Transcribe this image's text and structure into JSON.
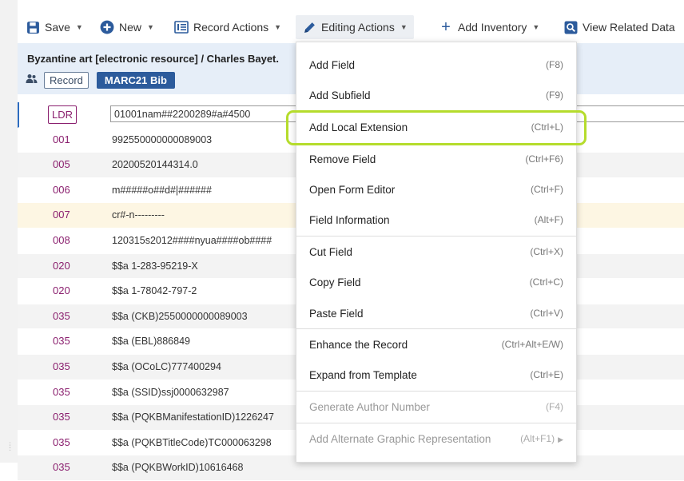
{
  "toolbar": {
    "save": "Save",
    "new": "New",
    "record_actions": "Record Actions",
    "editing_actions": "Editing Actions",
    "add_inventory": "Add Inventory",
    "view_related": "View Related Data"
  },
  "record": {
    "title": "Byzantine art [electronic resource] / Charles Bayet.",
    "badge_record": "Record",
    "badge_format": "MARC21 Bib"
  },
  "rows": [
    {
      "tag": "LDR",
      "value": "01001nam##2200289#a#4500"
    },
    {
      "tag": "001",
      "value": "992550000000089003"
    },
    {
      "tag": "005",
      "value": "20200520144314.0"
    },
    {
      "tag": "006",
      "value": "m#####o##d#|######"
    },
    {
      "tag": "007",
      "value": "cr#-n---------"
    },
    {
      "tag": "008",
      "value": "120315s2012####nyua####ob####"
    },
    {
      "tag": "020",
      "value": "$$a 1-283-95219-X"
    },
    {
      "tag": "020",
      "value": "$$a 1-78042-797-2"
    },
    {
      "tag": "035",
      "value": "$$a (CKB)2550000000089003"
    },
    {
      "tag": "035",
      "value": "$$a (EBL)886849"
    },
    {
      "tag": "035",
      "value": "$$a (OCoLC)777400294"
    },
    {
      "tag": "035",
      "value": "$$a (SSID)ssj0000632987"
    },
    {
      "tag": "035",
      "value": "$$a (PQKBManifestationID)1226247"
    },
    {
      "tag": "035",
      "value": "$$a (PQKBTitleCode)TC000063298"
    },
    {
      "tag": "035",
      "value": "$$a (PQKBWorkID)10616468"
    }
  ],
  "menu": {
    "items": [
      {
        "label": "Add Field",
        "shortcut": "(F8)"
      },
      {
        "label": "Add Subfield",
        "shortcut": "(F9)"
      },
      {
        "label": "Add Local Extension",
        "shortcut": "(Ctrl+L)"
      },
      {
        "label": "Remove Field",
        "shortcut": "(Ctrl+F6)"
      },
      {
        "label": "Open Form Editor",
        "shortcut": "(Ctrl+F)"
      },
      {
        "label": "Field Information",
        "shortcut": "(Alt+F)"
      },
      {
        "label": "Cut Field",
        "shortcut": "(Ctrl+X)"
      },
      {
        "label": "Copy Field",
        "shortcut": "(Ctrl+C)"
      },
      {
        "label": "Paste Field",
        "shortcut": "(Ctrl+V)"
      },
      {
        "label": "Enhance the Record",
        "shortcut": "(Ctrl+Alt+E/W)"
      },
      {
        "label": "Expand from Template",
        "shortcut": "(Ctrl+E)"
      },
      {
        "label": "Generate Author Number",
        "shortcut": "(F4)"
      },
      {
        "label": "Add Alternate Graphic Representation",
        "shortcut": "(Alt+F1)"
      }
    ]
  },
  "colors": {
    "tag": "#8a1f6e",
    "accent": "#2c5b9c",
    "header_bg": "#e6eef8",
    "highlight_ring": "#b5dc2c"
  }
}
